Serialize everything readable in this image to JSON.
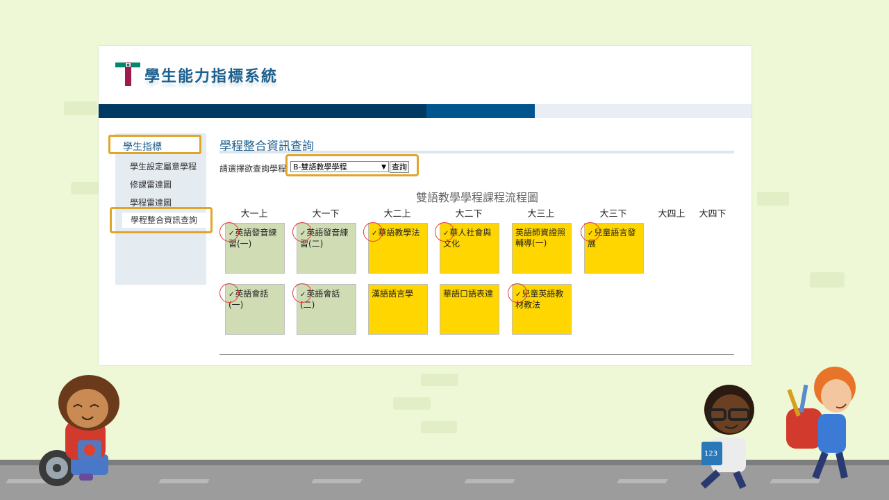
{
  "header": {
    "system_title": "學生能力指標系統",
    "logo_letter": "T"
  },
  "sidebar": {
    "section_title": "學生指標",
    "items": [
      {
        "label": "學生設定屬意學程"
      },
      {
        "label": "修課雷達圖"
      },
      {
        "label": "學程雷達圖"
      },
      {
        "label": "學程整合資訊查詢"
      }
    ]
  },
  "main": {
    "title": "學程整合資訊查詢",
    "query_label": "請選擇欲查詢學程",
    "selected_program": "B-雙語教學學程",
    "query_button": "查詢",
    "chart_title": "雙語教學學程課程流程圖",
    "semesters": [
      "大一上",
      "大一下",
      "大二上",
      "大二下",
      "大三上",
      "大三下",
      "大四上",
      "大四下"
    ],
    "courses_row1": [
      {
        "name": "英語發音練習(一)",
        "checked": true,
        "color": "#d0dcb4"
      },
      {
        "name": "英語發音練習(二)",
        "checked": true,
        "color": "#d0dcb4"
      },
      {
        "name": "華語教學法",
        "checked": true,
        "color": "#ffd600"
      },
      {
        "name": "華人社會與文化",
        "checked": true,
        "color": "#ffd600"
      },
      {
        "name": "英語師資證照輔導(一)",
        "checked": false,
        "color": "#ffd600"
      },
      {
        "name": "兒童語言發展",
        "checked": true,
        "color": "#ffd600"
      }
    ],
    "courses_row2": [
      {
        "name": "英語會話(一)",
        "checked": true,
        "color": "#d0dcb4"
      },
      {
        "name": "英語會話(二)",
        "checked": true,
        "color": "#d0dcb4"
      },
      {
        "name": "漢語語言學",
        "checked": false,
        "color": "#ffd600"
      },
      {
        "name": "華語口語表達",
        "checked": false,
        "color": "#ffd600"
      },
      {
        "name": "兒童英語教材教法",
        "checked": true,
        "color": "#ffd600"
      }
    ],
    "check_mark": "✓"
  },
  "colors": {
    "accent_frame": "#e0a52a",
    "brand_dark": "#003a63",
    "brand_mid": "#00558f",
    "course_green": "#d0dcb4",
    "course_yellow": "#ffd600",
    "check_circle": "#e23b3b"
  }
}
